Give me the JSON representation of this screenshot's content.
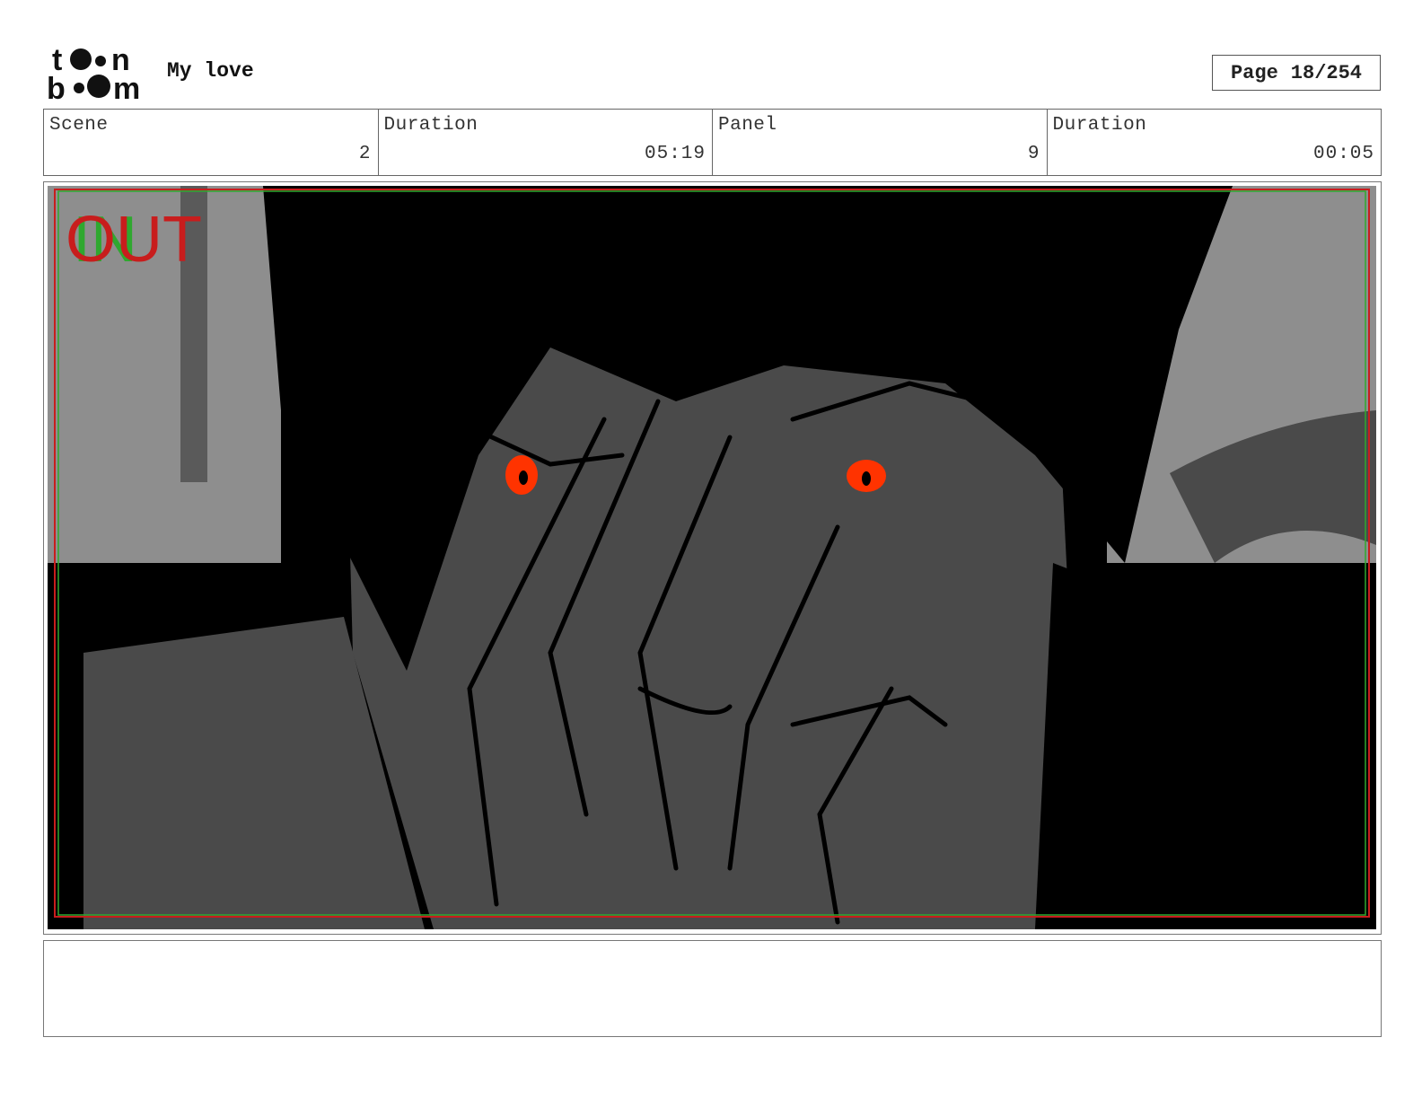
{
  "header": {
    "logo_text": "toon boom",
    "project_title": "My love",
    "page_label": "Page",
    "page_value": "18/254"
  },
  "info": {
    "scene_label": "Scene",
    "scene_value": "2",
    "scene_duration_label": "Duration",
    "scene_duration_value": "05:19",
    "panel_label": "Panel",
    "panel_value": "9",
    "panel_duration_label": "Duration",
    "panel_duration_value": "00:05"
  },
  "panel": {
    "overlay_in": "IN",
    "overlay_out": "OUT",
    "colors": {
      "in": "#2fa82f",
      "out": "#c81d1d",
      "eye": "#ff3300",
      "bg_light": "#8e8e8e",
      "mid": "#4a4a4a",
      "dark": "#000000"
    }
  },
  "caption": {
    "text": ""
  }
}
